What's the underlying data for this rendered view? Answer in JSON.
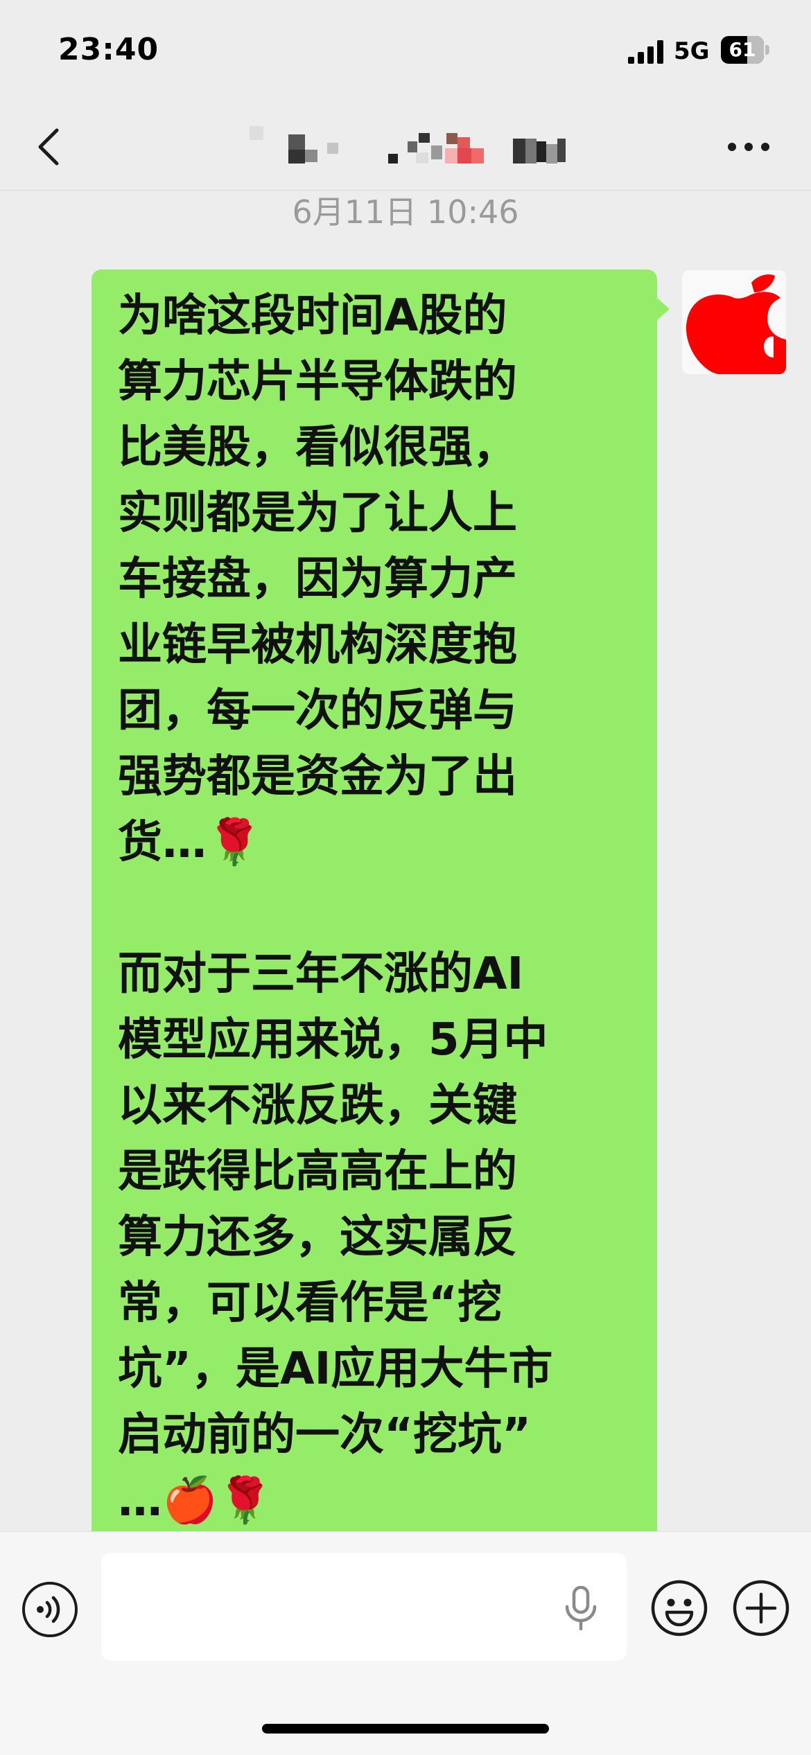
{
  "status_bar": {
    "time": "23:40",
    "network": "5G",
    "battery_level": "61",
    "battery_fraction": 0.61,
    "icons": [
      "signal-icon",
      "battery-icon"
    ]
  },
  "nav": {
    "back_icon": "chevron-left-icon",
    "title_hidden": true,
    "more_icon": "more-icon"
  },
  "chat": {
    "timestamp": "6月11日 10:46",
    "messages": [
      {
        "sender": "self",
        "avatar": "apple-logo-avatar",
        "text": "为啥这段时间A股的\n算力芯片半导体跌的\n比美股，看似很强，\n实则都是为了让人上\n车接盘，因为算力产\n业链早被机构深度抱\n团，每一次的反弹与\n强势都是资金为了出\n货…🌹\n\n而对于三年不涨的AI\n模型应用来说，5月中\n以来不涨反跌，关键\n是跌得比高高在上的\n算力还多，这实属反\n常，可以看作是“挖\n坑”，是AI应用大牛市\n启动前的一次“挖坑”\n…🍎🌹"
      }
    ]
  },
  "input_bar": {
    "placeholder": "",
    "icons": [
      "voice-icon",
      "mic-icon",
      "emoji-icon",
      "plus-icon"
    ]
  },
  "colors": {
    "bubble": "#95ec69",
    "background": "#ededed",
    "avatar_red": "#ff0000"
  }
}
